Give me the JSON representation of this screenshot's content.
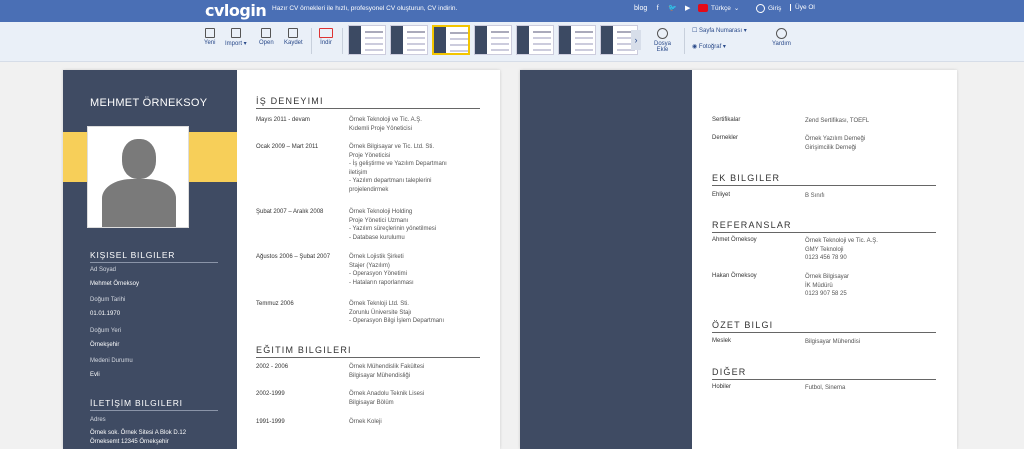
{
  "topbar": {
    "logo": "cvlogin",
    "tagline": "Hazır CV örnekleri ile hızlı, profesyonel CV oluşturun, CV indirin.",
    "blog": "blog",
    "language": "Türkçe",
    "login": "Giriş",
    "signup": "Üye Ol"
  },
  "toolbar": {
    "yeni": "Yeni",
    "import": "Import",
    "open": "Open",
    "kaydet": "Kaydet",
    "indir": "İndir",
    "dosya": "Dosya",
    "ekle": "Ekle",
    "sayfa": "Sayfa Numarası",
    "foto": "Fotoğraf",
    "yardim": "Yardım"
  },
  "cv": {
    "name": "MEHMET ÖRNEKSOY",
    "kisisel": {
      "title": "KIŞISEL BILGILER",
      "ad_label": "Ad Soyad",
      "ad": "Mehmet Örneksoy",
      "dt_label": "Doğum Tarihi",
      "dt": "01.01.1970",
      "dy_label": "Doğum Yeri",
      "dy": "Örnekşehir",
      "md_label": "Medeni Durumu",
      "md": "Evli"
    },
    "iletisim": {
      "title": "İLETİŞİM BILGILERI",
      "adres_label": "Adres",
      "adres1": "Örnek sok. Örnek Sitesi A Blok D.12",
      "adres2": "Örneksemt 12345 Örnekşehir"
    },
    "is": {
      "title": "İŞ DENEYIMI",
      "items": [
        {
          "date": "Mayıs 2011 - devam",
          "l1": "Örnek Teknoloji ve Tic. A.Ş.",
          "l2": "Kıdemli Proje Yöneticisi",
          "l3": "",
          "l4": "",
          "l5": "",
          "l6": ""
        },
        {
          "date": "Ocak 2009 – Mart 2011",
          "l1": "Örnek Bilgisayar ve Tic. Ltd. Sti.",
          "l2": "Proje Yöneticisi",
          "l3": "- İş geliştirme ve Yazılım Departmanı",
          "l4": "iletişim",
          "l5": "- Yazılım departmanı taleplerini",
          "l6": "projelendirmek"
        },
        {
          "date": "Şubat 2007 – Aralık 2008",
          "l1": "Örnek Teknoloji Holding",
          "l2": "Proje Yönetici Uzmanı",
          "l3": "- Yazılım süreçlerinin yönetilmesi",
          "l4": "- Database kurulumu",
          "l5": "",
          "l6": ""
        },
        {
          "date": "Ağustos 2006 – Şubat 2007",
          "l1": "Örnek Lojistik Şirketi",
          "l2": "Stajer (Yazılım)",
          "l3": "- Operasyon Yönetimi",
          "l4": "- Hataların raporlanması",
          "l5": "",
          "l6": ""
        },
        {
          "date": "Temmuz 2006",
          "l1": "Örnek Teknloji Ltd. Sti.",
          "l2": "Zorunlu Üniversite Stajı",
          "l3": "- Operasyon Bilgi İşlem Departmanı",
          "l4": "",
          "l5": "",
          "l6": ""
        }
      ]
    },
    "egitim": {
      "title": "EĞITIM BILGILERI",
      "items": [
        {
          "date": "2002 - 2006",
          "l1": "Örnek Mühendislik Fakültesi",
          "l2": "Bilgisayar Mühendisliği"
        },
        {
          "date": "2002-1999",
          "l1": "Örnek Anadolu Teknik Lisesi",
          "l2": "Bilgisayar Bölüm"
        },
        {
          "date": "1991-1999",
          "l1": "Örnek Koleji",
          "l2": ""
        }
      ]
    },
    "sertifikalar": {
      "label": "Sertifikalar",
      "value": "Zend Sertifikası, TOEFL"
    },
    "dernekler": {
      "label": "Dernekler",
      "v1": "Örnek Yazılım Derneği",
      "v2": "Girişimcilik Derneği"
    },
    "ek": {
      "title": "EK BILGILER",
      "label": "Ehliyet",
      "value": "B Sınıfı"
    },
    "ref": {
      "title": "REFERANSLAR",
      "items": [
        {
          "name": "Ahmet Örneksoy",
          "l1": "Örnek Teknoloji ve Tic. A.Ş.",
          "l2": "GMY Teknoloji",
          "l3": "0123 456 78 90"
        },
        {
          "name": "Hakan Örneksoy",
          "l1": "Örnek Bilgisayar",
          "l2": "İK Müdürü",
          "l3": "0123 907 58 25"
        }
      ]
    },
    "ozet": {
      "title": "ÖZET BILGI",
      "label": "Meslek",
      "value": "Bilgisayar Mühendisi"
    },
    "diger": {
      "title": "DIĞER",
      "label": "Hobiler",
      "value": "Futbol, Sinema"
    }
  }
}
